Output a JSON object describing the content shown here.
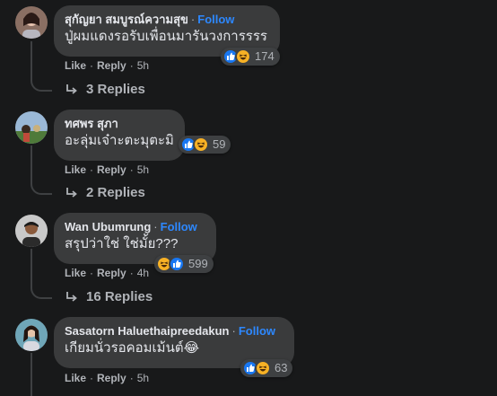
{
  "ui": {
    "dot": "·",
    "follow_label": "Follow",
    "like_label": "Like",
    "reply_label": "Reply",
    "sep": "·"
  },
  "comments": [
    {
      "author": "สุกัญยา สมบูรณ์ความสุข",
      "text": "ปู่ผมแดงรอรับเพื่อนมารันวงการรรร",
      "reaction_icons": [
        "like-icon",
        "haha-icon"
      ],
      "reaction_count": "174",
      "time": "5h",
      "replies": "3 Replies",
      "show_follow": true
    },
    {
      "author": "ทศพร สุภา",
      "text": "อะลุ่มเจ๋าะตะมุตะมิ",
      "reaction_icons": [
        "like-icon",
        "haha-icon"
      ],
      "reaction_count": "59",
      "time": "5h",
      "replies": "2 Replies",
      "show_follow": false
    },
    {
      "author": "Wan Ubumrung",
      "text": "สรุปว่าใช่ ใช่มั้ย???",
      "reaction_icons": [
        "haha-icon",
        "like-icon"
      ],
      "reaction_count": "599",
      "time": "4h",
      "replies": "16 Replies",
      "show_follow": true
    },
    {
      "author": "Sasatorn Haluethaipreedakun",
      "text": "เกียมนั่วรอคอมเม้นต์😂",
      "reaction_icons": [
        "like-icon",
        "haha-icon"
      ],
      "reaction_count": "63",
      "time": "5h",
      "replies": "",
      "show_follow": true
    }
  ],
  "colors": {
    "background": "#18191a",
    "bubble": "#3a3b3c",
    "follow": "#2d88ff",
    "like_blue": "#1877f2",
    "haha_yellow": "#f7b125"
  }
}
